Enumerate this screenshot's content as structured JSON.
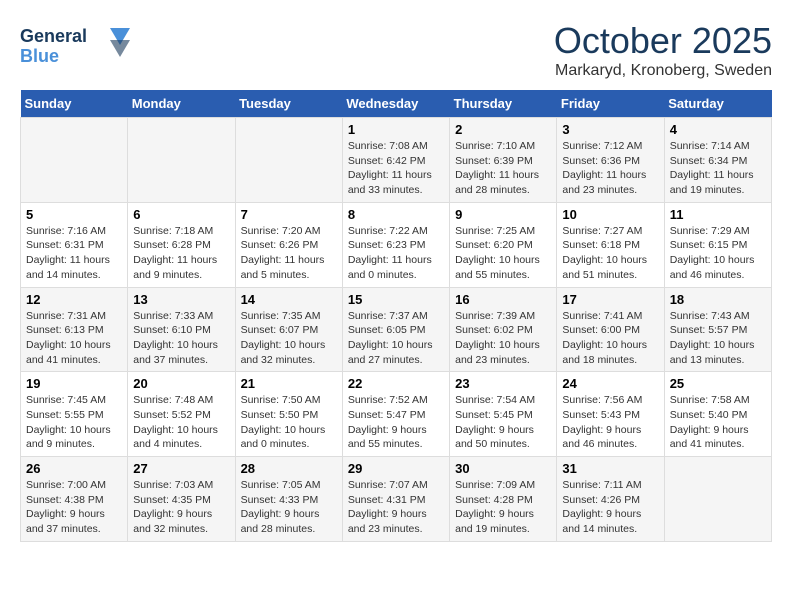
{
  "logo": {
    "line1": "General",
    "line2": "Blue"
  },
  "title": "October 2025",
  "subtitle": "Markaryd, Kronoberg, Sweden",
  "days_of_week": [
    "Sunday",
    "Monday",
    "Tuesday",
    "Wednesday",
    "Thursday",
    "Friday",
    "Saturday"
  ],
  "weeks": [
    [
      {
        "day": "",
        "info": ""
      },
      {
        "day": "",
        "info": ""
      },
      {
        "day": "",
        "info": ""
      },
      {
        "day": "1",
        "info": "Sunrise: 7:08 AM\nSunset: 6:42 PM\nDaylight: 11 hours\nand 33 minutes."
      },
      {
        "day": "2",
        "info": "Sunrise: 7:10 AM\nSunset: 6:39 PM\nDaylight: 11 hours\nand 28 minutes."
      },
      {
        "day": "3",
        "info": "Sunrise: 7:12 AM\nSunset: 6:36 PM\nDaylight: 11 hours\nand 23 minutes."
      },
      {
        "day": "4",
        "info": "Sunrise: 7:14 AM\nSunset: 6:34 PM\nDaylight: 11 hours\nand 19 minutes."
      }
    ],
    [
      {
        "day": "5",
        "info": "Sunrise: 7:16 AM\nSunset: 6:31 PM\nDaylight: 11 hours\nand 14 minutes."
      },
      {
        "day": "6",
        "info": "Sunrise: 7:18 AM\nSunset: 6:28 PM\nDaylight: 11 hours\nand 9 minutes."
      },
      {
        "day": "7",
        "info": "Sunrise: 7:20 AM\nSunset: 6:26 PM\nDaylight: 11 hours\nand 5 minutes."
      },
      {
        "day": "8",
        "info": "Sunrise: 7:22 AM\nSunset: 6:23 PM\nDaylight: 11 hours\nand 0 minutes."
      },
      {
        "day": "9",
        "info": "Sunrise: 7:25 AM\nSunset: 6:20 PM\nDaylight: 10 hours\nand 55 minutes."
      },
      {
        "day": "10",
        "info": "Sunrise: 7:27 AM\nSunset: 6:18 PM\nDaylight: 10 hours\nand 51 minutes."
      },
      {
        "day": "11",
        "info": "Sunrise: 7:29 AM\nSunset: 6:15 PM\nDaylight: 10 hours\nand 46 minutes."
      }
    ],
    [
      {
        "day": "12",
        "info": "Sunrise: 7:31 AM\nSunset: 6:13 PM\nDaylight: 10 hours\nand 41 minutes."
      },
      {
        "day": "13",
        "info": "Sunrise: 7:33 AM\nSunset: 6:10 PM\nDaylight: 10 hours\nand 37 minutes."
      },
      {
        "day": "14",
        "info": "Sunrise: 7:35 AM\nSunset: 6:07 PM\nDaylight: 10 hours\nand 32 minutes."
      },
      {
        "day": "15",
        "info": "Sunrise: 7:37 AM\nSunset: 6:05 PM\nDaylight: 10 hours\nand 27 minutes."
      },
      {
        "day": "16",
        "info": "Sunrise: 7:39 AM\nSunset: 6:02 PM\nDaylight: 10 hours\nand 23 minutes."
      },
      {
        "day": "17",
        "info": "Sunrise: 7:41 AM\nSunset: 6:00 PM\nDaylight: 10 hours\nand 18 minutes."
      },
      {
        "day": "18",
        "info": "Sunrise: 7:43 AM\nSunset: 5:57 PM\nDaylight: 10 hours\nand 13 minutes."
      }
    ],
    [
      {
        "day": "19",
        "info": "Sunrise: 7:45 AM\nSunset: 5:55 PM\nDaylight: 10 hours\nand 9 minutes."
      },
      {
        "day": "20",
        "info": "Sunrise: 7:48 AM\nSunset: 5:52 PM\nDaylight: 10 hours\nand 4 minutes."
      },
      {
        "day": "21",
        "info": "Sunrise: 7:50 AM\nSunset: 5:50 PM\nDaylight: 10 hours\nand 0 minutes."
      },
      {
        "day": "22",
        "info": "Sunrise: 7:52 AM\nSunset: 5:47 PM\nDaylight: 9 hours\nand 55 minutes."
      },
      {
        "day": "23",
        "info": "Sunrise: 7:54 AM\nSunset: 5:45 PM\nDaylight: 9 hours\nand 50 minutes."
      },
      {
        "day": "24",
        "info": "Sunrise: 7:56 AM\nSunset: 5:43 PM\nDaylight: 9 hours\nand 46 minutes."
      },
      {
        "day": "25",
        "info": "Sunrise: 7:58 AM\nSunset: 5:40 PM\nDaylight: 9 hours\nand 41 minutes."
      }
    ],
    [
      {
        "day": "26",
        "info": "Sunrise: 7:00 AM\nSunset: 4:38 PM\nDaylight: 9 hours\nand 37 minutes."
      },
      {
        "day": "27",
        "info": "Sunrise: 7:03 AM\nSunset: 4:35 PM\nDaylight: 9 hours\nand 32 minutes."
      },
      {
        "day": "28",
        "info": "Sunrise: 7:05 AM\nSunset: 4:33 PM\nDaylight: 9 hours\nand 28 minutes."
      },
      {
        "day": "29",
        "info": "Sunrise: 7:07 AM\nSunset: 4:31 PM\nDaylight: 9 hours\nand 23 minutes."
      },
      {
        "day": "30",
        "info": "Sunrise: 7:09 AM\nSunset: 4:28 PM\nDaylight: 9 hours\nand 19 minutes."
      },
      {
        "day": "31",
        "info": "Sunrise: 7:11 AM\nSunset: 4:26 PM\nDaylight: 9 hours\nand 14 minutes."
      },
      {
        "day": "",
        "info": ""
      }
    ]
  ]
}
